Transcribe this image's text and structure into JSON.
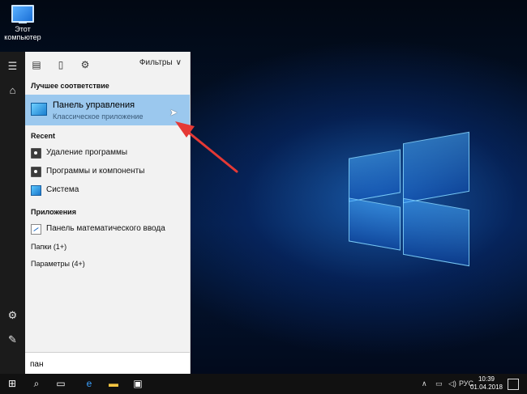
{
  "desktop": {
    "icon_label": "Этот компьютер"
  },
  "search": {
    "filters_label": "Фильтры",
    "best_match_label": "Лучшее соответствие",
    "best_match": {
      "title": "Панель управления",
      "subtitle": "Классическое приложение"
    },
    "recent_label": "Recent",
    "recent_items": [
      {
        "label": "Удаление программы"
      },
      {
        "label": "Программы и компоненты"
      },
      {
        "label": "Система"
      }
    ],
    "apps_label": "Приложения",
    "apps_items": [
      {
        "label": "Панель математического ввода"
      }
    ],
    "folders_label": "Папки (1+)",
    "settings_label": "Параметры (4+)",
    "query": "пан"
  },
  "taskbar": {
    "language": "РУС",
    "time": "10:39",
    "date": "01.04.2018"
  },
  "colors": {
    "selection": "#9bc8ee",
    "accent_arrow": "#e53935"
  }
}
